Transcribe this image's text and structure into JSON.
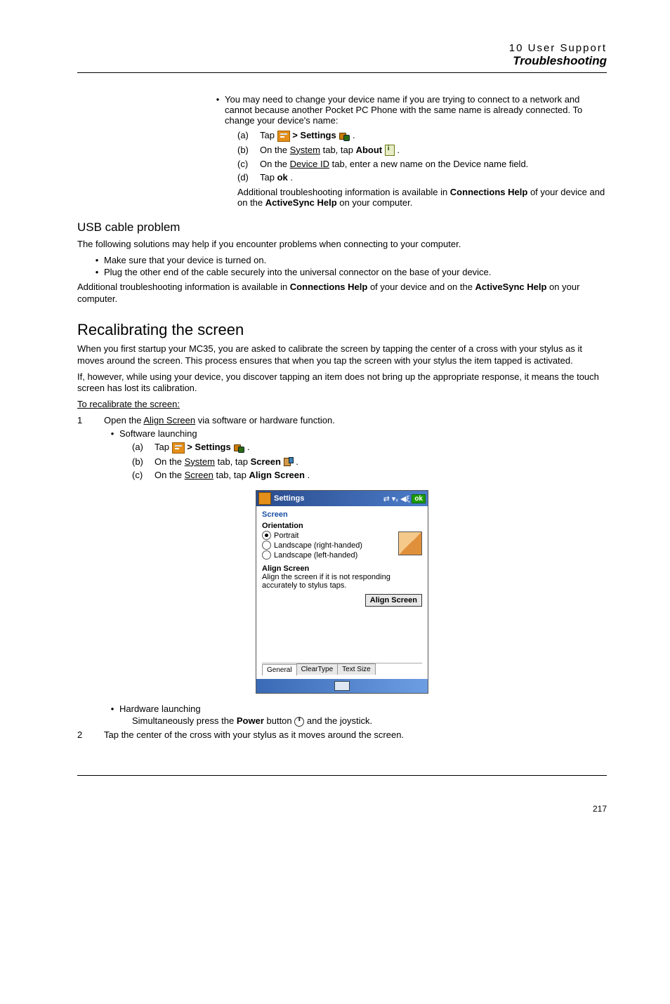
{
  "header": {
    "chapter": "10 User Support",
    "section": "Troubleshooting"
  },
  "top_bullet": "You may need to change your device name if you are trying to connect to a network and cannot because another Pocket PC Phone with the same name is already connected. To change your device's name:",
  "steps_a": {
    "a_pre": "Tap ",
    "a_mid": " > Settings ",
    "a_post": ".",
    "b_pre": "On the ",
    "b_system": "System",
    "b_mid": " tab, tap ",
    "b_bold": "About",
    "b_post": " .",
    "c_pre": "On the ",
    "c_device": "Device ID",
    "c_post": " tab, enter a new name on the Device name field.",
    "d_pre": "Tap ",
    "d_bold": "ok",
    "d_post": "."
  },
  "note1_pre": "Additional troubleshooting information is available in ",
  "note1_b1": "Connections Help",
  "note1_mid": " of your device and on the ",
  "note1_b2": "ActiveSync Help",
  "note1_post": " on your computer.",
  "usb": {
    "heading": "USB cable problem",
    "intro": "The following solutions may help if you encounter problems when connecting to your computer.",
    "b1": "Make sure that your device is turned on.",
    "b2": "Plug the other end of the cable securely into the universal connector on the base of your device.",
    "note_pre": "Additional troubleshooting information is available in ",
    "note_b1": "Connections Help",
    "note_mid": " of your device and on the ",
    "note_b2": "ActiveSync Help",
    "note_post": " on your computer."
  },
  "recal": {
    "title": "Recalibrating the screen",
    "p1": "When you first startup your MC35, you are asked to calibrate the screen by tapping the center of a cross with your stylus as it moves around the screen. This process ensures that when you tap the screen with your stylus the item tapped is activated.",
    "p2": "If, however, while using your device, you discover tapping an item does not bring up the appropriate response, it means the touch screen has lost its calibration.",
    "proc_label": "To recalibrate the screen:",
    "n1_pre": "Open the ",
    "n1_u": "Align Screen",
    "n1_post": " via software or hardware function.",
    "soft_label": "Software launching",
    "sa_pre": "Tap ",
    "sa_mid": " > Settings ",
    "sa_post": ".",
    "sb_pre": "On the ",
    "sb_u": "System",
    "sb_mid": " tab, tap ",
    "sb_b": "Screen",
    "sb_post": " .",
    "sc_pre": "On the ",
    "sc_u": "Screen",
    "sc_mid": " tab, tap ",
    "sc_b": "Align Screen",
    "sc_post": ".",
    "hw_label": "Hardware launching",
    "hw_pre": "Simultaneously press the ",
    "hw_b": "Power",
    "hw_mid": " button  ",
    "hw_post": " and the joystick.",
    "n2": "Tap the center of the cross with your stylus as it moves around the screen."
  },
  "device": {
    "title": "Settings",
    "ok": "ok",
    "screen": "Screen",
    "orientation": "Orientation",
    "portrait": "Portrait",
    "land_r": "Landscape (right-handed)",
    "land_l": "Landscape (left-handed)",
    "align_h": "Align Screen",
    "align_desc": "Align the screen if it is not responding accurately to stylus taps.",
    "align_btn": "Align Screen",
    "tab1": "General",
    "tab2": "ClearType",
    "tab3": "Text Size"
  },
  "page_num": "217"
}
